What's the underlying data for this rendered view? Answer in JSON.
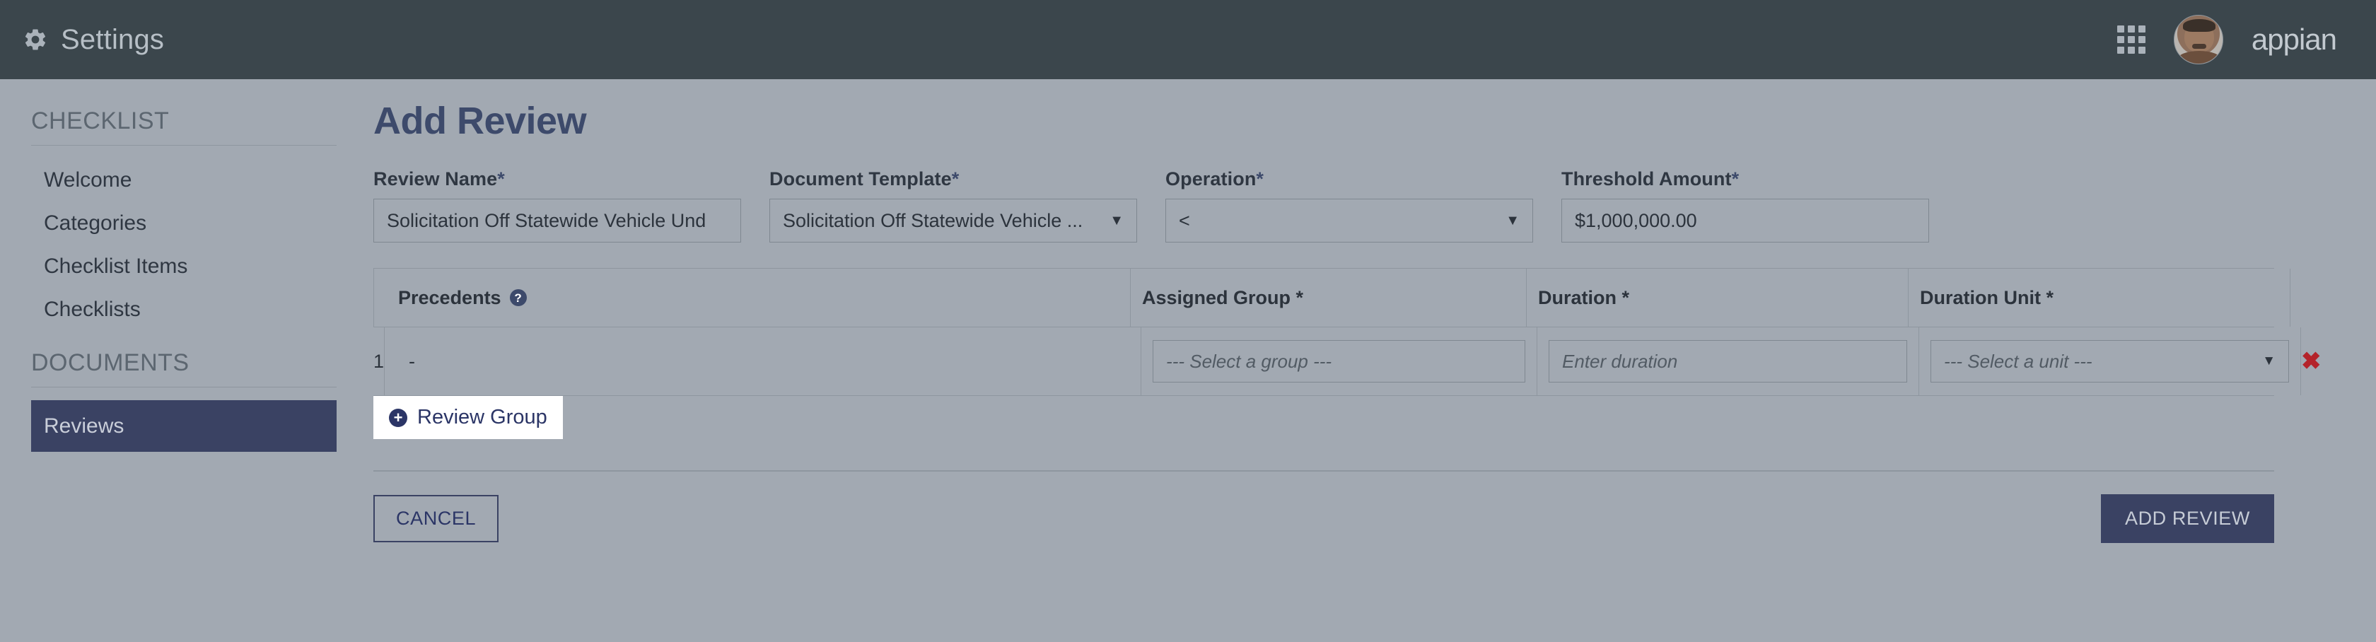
{
  "topbar": {
    "gear_icon": "gear-icon",
    "title": "Settings",
    "apps_icon": "grid-apps-icon",
    "avatar_label": "user-avatar",
    "brand": "appian"
  },
  "sidebar": {
    "sections": [
      {
        "heading": "CHECKLIST",
        "items": [
          {
            "label": "Welcome",
            "active": false
          },
          {
            "label": "Categories",
            "active": false
          },
          {
            "label": "Checklist Items",
            "active": false
          },
          {
            "label": "Checklists",
            "active": false
          }
        ]
      },
      {
        "heading": "DOCUMENTS",
        "items": [
          {
            "label": "Reviews",
            "active": true
          }
        ]
      }
    ]
  },
  "main": {
    "page_title": "Add Review",
    "fields": [
      {
        "label": "Review Name",
        "required": "*",
        "value": "Solicitation Off Statewide Vehicle Und",
        "type": "text"
      },
      {
        "label": "Document Template",
        "required": "*",
        "value": "Solicitation Off Statewide Vehicle ...",
        "type": "dropdown"
      },
      {
        "label": "Operation",
        "required": "*",
        "value": "<",
        "type": "dropdown"
      },
      {
        "label": "Threshold Amount",
        "required": "*",
        "value": "$1,000,000.00",
        "type": "text"
      }
    ],
    "grid": {
      "columns": {
        "number": "",
        "precedents": "Precedents",
        "precedents_help_icon": "help-icon",
        "assigned_group": "Assigned Group *",
        "duration": "Duration *",
        "duration_unit": "Duration Unit *"
      },
      "rows": [
        {
          "number": "1",
          "precedents": "-",
          "assigned_group_placeholder": "--- Select a group ---",
          "duration_placeholder": "Enter duration",
          "duration_unit_placeholder": "--- Select a unit ---",
          "delete_label": "✖"
        }
      ],
      "add_button": {
        "icon": "plus-circle-icon",
        "label": "Review Group"
      }
    },
    "actions": {
      "cancel_label": "CANCEL",
      "submit_label": "ADD REVIEW"
    }
  },
  "colors": {
    "topbar_bg": "#3b464c",
    "page_bg": "#a2a9b2",
    "accent_navy": "#3a4263",
    "title_navy": "#3d4a6b",
    "delete_red": "#b4232a"
  }
}
